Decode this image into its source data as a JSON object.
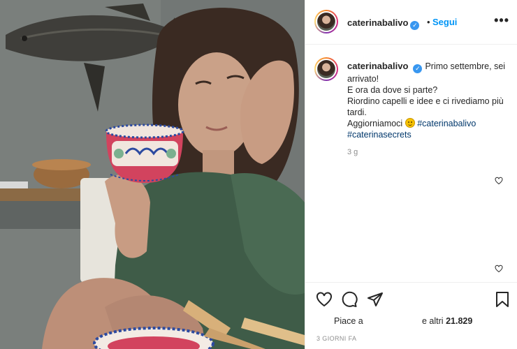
{
  "post": {
    "photo_description_name": "post-photo"
  },
  "header": {
    "username": "caterinabalivo",
    "verified_mark": "✓",
    "separator": "•",
    "follow_label": "Segui",
    "more_label": "•••"
  },
  "caption": {
    "username": "caterinabalivo",
    "verified_mark": "✓",
    "line1": "Primo settembre, sei arrivato!",
    "line2": "E ora da dove si parte?",
    "line3": "Riordino capelli e idee e ci rivediamo più tardi.",
    "line4_text": "Aggiorniamoci",
    "hashtag1": "#caterinabalivo",
    "hashtag2": "#caterinasecrets",
    "age": "3 g"
  },
  "actions": {
    "likes_prefix": "Piace a",
    "likes_suffix_prefix": "e altri",
    "likes_count": "21.829",
    "timestamp": "3 GIORNI FA"
  },
  "icons": {
    "like": "heart-icon",
    "comment": "comment-icon",
    "share": "share-icon",
    "save": "bookmark-icon",
    "more": "more-options-icon",
    "verified": "verified-badge-icon"
  },
  "colors": {
    "follow_blue": "#0095f6",
    "verified_blue": "#3897f0",
    "hashtag": "#00376b",
    "muted": "#8e8e8e",
    "text": "#262626"
  }
}
